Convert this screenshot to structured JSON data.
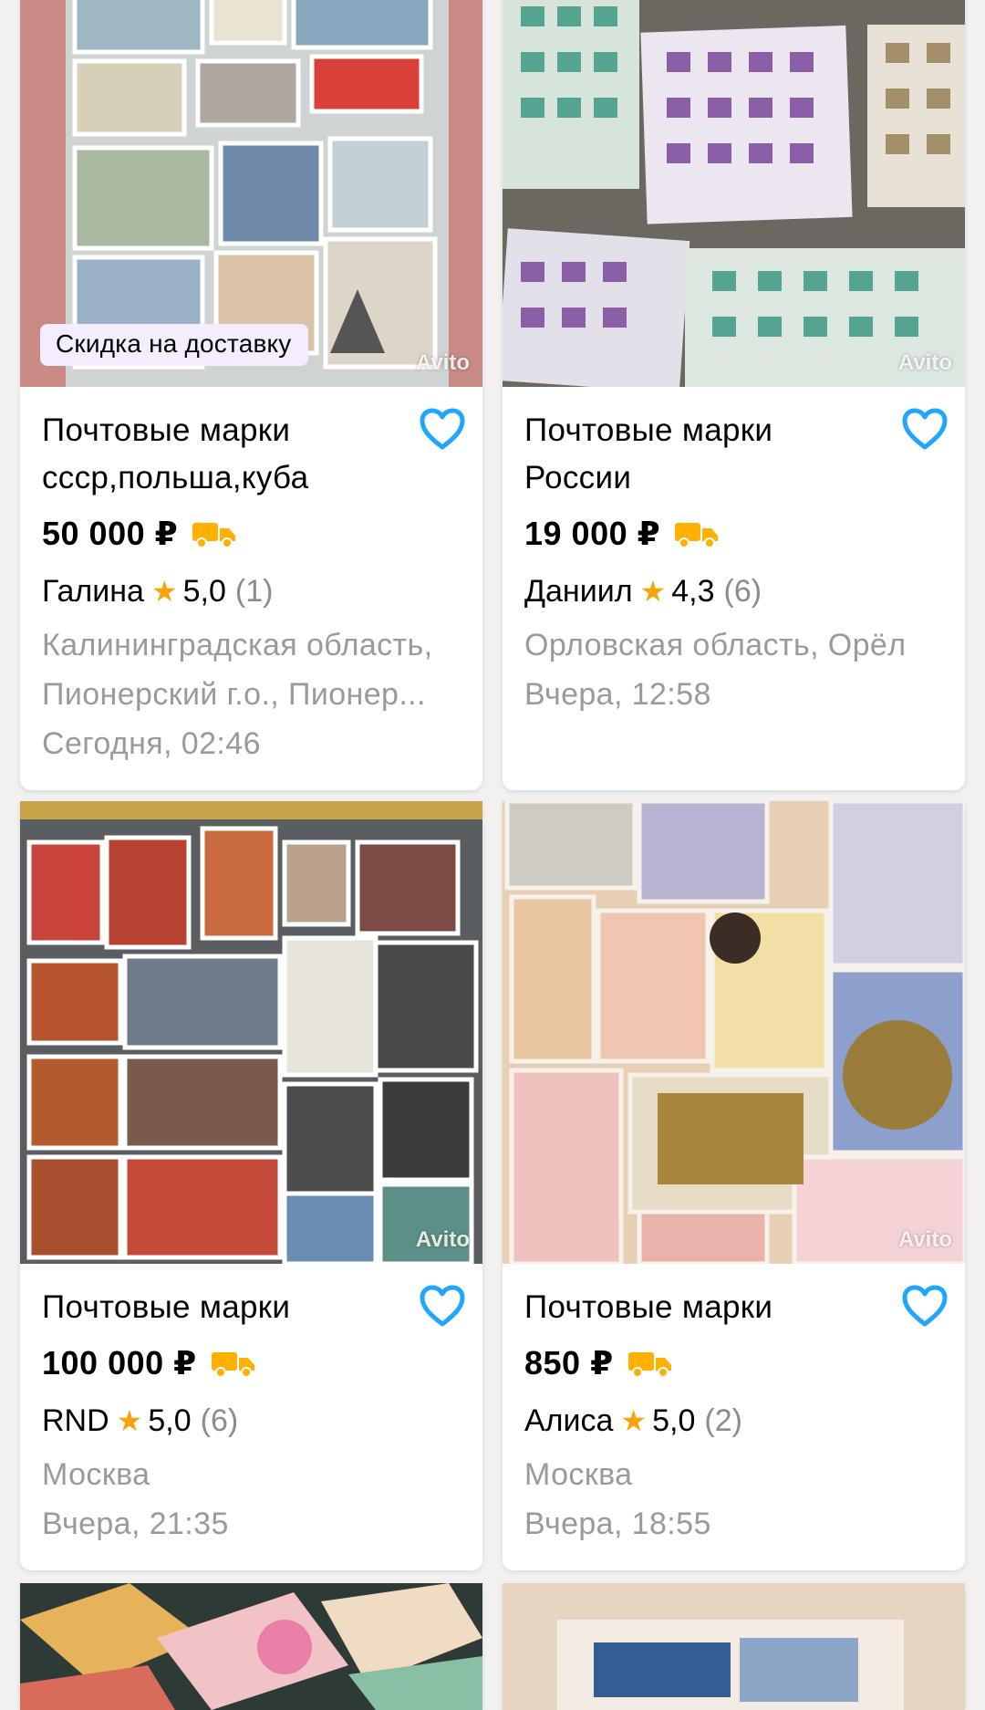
{
  "watermark": "Avito",
  "listings": [
    {
      "promo": "Скидка на доставку",
      "title": "Почтовые марки ссср,польша,куба",
      "price": "50 000 ₽",
      "seller": "Галина",
      "rating": "5,0",
      "reviews": "(1)",
      "location": "Калининградская область, Пионерский г.о., Пионер...",
      "date": "Сегодня, 02:46"
    },
    {
      "title": "Почтовые марки России",
      "price": "19 000 ₽",
      "seller": "Даниил",
      "rating": "4,3",
      "reviews": "(6)",
      "location": "Орловская область, Орёл",
      "date": "Вчера, 12:58"
    },
    {
      "title": "Почтовые марки",
      "price": "100 000 ₽",
      "seller": "RND",
      "rating": "5,0",
      "reviews": "(6)",
      "location": "Москва",
      "date": "Вчера, 21:35"
    },
    {
      "title": "Почтовые марки",
      "price": "850 ₽",
      "seller": "Алиса",
      "rating": "5,0",
      "reviews": "(2)",
      "location": "Москва",
      "date": "Вчера, 18:55"
    }
  ],
  "icons": {
    "favorite": "heart-outline-icon",
    "delivery": "truck-icon",
    "rating": "star-icon"
  },
  "colors": {
    "accent_heart": "#1ea7fd",
    "delivery_truck": "#ffb000",
    "star": "#f7a30b",
    "promo_bg": "#f3edfd",
    "muted_text": "#9a9a9a"
  }
}
